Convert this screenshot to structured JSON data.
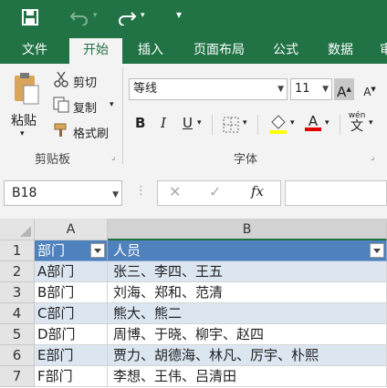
{
  "tabs": [
    "文件",
    "开始",
    "插入",
    "页面布局",
    "公式",
    "数据",
    "审"
  ],
  "clipboard": {
    "paste": "粘贴",
    "cut": "剪切",
    "copy": "复制",
    "format_painter": "格式刷",
    "group": "剪贴板"
  },
  "font": {
    "name": "等线",
    "size": "11",
    "group": "字体",
    "phonetic": "wén"
  },
  "formula_bar": {
    "name_box": "B18",
    "fx": "fx"
  },
  "sheet": {
    "columns": [
      "A",
      "B"
    ],
    "rows": [
      {
        "num": "1",
        "a": "部门",
        "b": "人员"
      },
      {
        "num": "2",
        "a": "A部门",
        "b": "张三、李四、王五"
      },
      {
        "num": "3",
        "a": "B部门",
        "b": "刘海、郑和、范清"
      },
      {
        "num": "4",
        "a": "C部门",
        "b": "熊大、熊二"
      },
      {
        "num": "5",
        "a": "D部门",
        "b": "周博、于晓、柳宇、赵四"
      },
      {
        "num": "6",
        "a": "E部门",
        "b": "贾力、胡德海、林凡、厉宇、朴熙"
      },
      {
        "num": "7",
        "a": "F部门",
        "b": "李想、王伟、吕清田"
      }
    ]
  },
  "colors": {
    "ribbon_green": "#217346",
    "table_header": "#4f81bd",
    "band": "#dce6f1"
  }
}
